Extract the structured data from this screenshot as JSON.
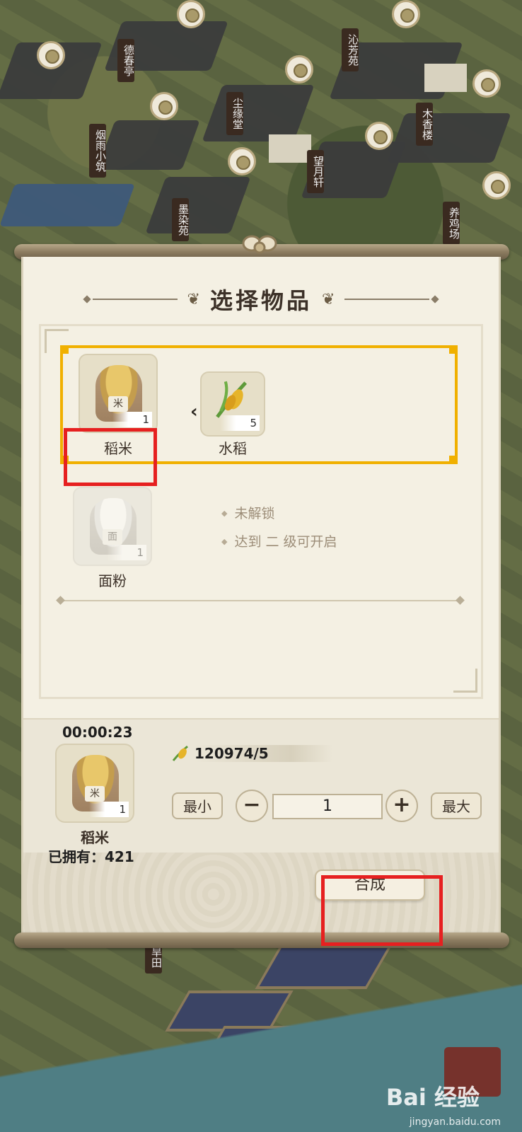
{
  "background": {
    "signs": [
      "德春亭",
      "沁芳苑",
      "尘缘堂",
      "烟雨小筑",
      "木香楼",
      "望月轩",
      "墨染苑",
      "养鸡场",
      "旱田"
    ]
  },
  "dialog": {
    "title": "选择物品",
    "recipes": [
      {
        "output": {
          "name": "稻米",
          "count": "1",
          "label_char": "米"
        },
        "inputs": [
          {
            "name": "水稻",
            "count": "5"
          }
        ],
        "selected": true,
        "locked": false
      },
      {
        "output": {
          "name": "面粉",
          "count": "1",
          "label_char": "面"
        },
        "locked": true,
        "lock_lines": [
          "未解锁",
          "达到 二 级可开启"
        ]
      }
    ]
  },
  "craft": {
    "timer": "00:00:23",
    "item_name": "稻米",
    "item_count": "1",
    "item_label_char": "米",
    "owned_text": "已拥有：421",
    "resource_text": "120974/5",
    "min_label": "最小",
    "max_label": "最大",
    "minus_symbol": "−",
    "plus_symbol": "+",
    "quantity": "1",
    "synthesize_label": "合成"
  },
  "watermark": {
    "brand": "Bai 经验",
    "url": "jingyan.baidu.com"
  },
  "colors": {
    "highlight": "#e62020",
    "selection": "#f0b000",
    "panel": "#f4f0e3"
  }
}
